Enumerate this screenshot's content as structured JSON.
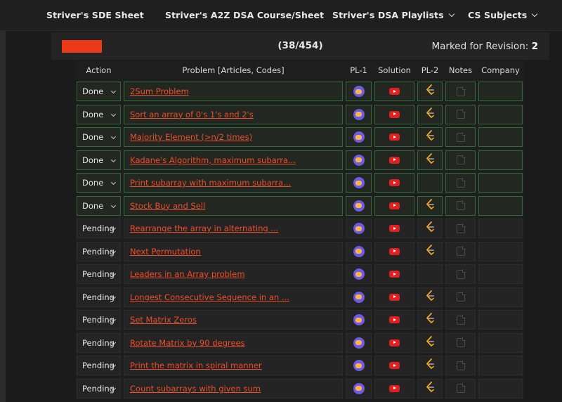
{
  "nav": {
    "items": [
      {
        "label": "Striver's SDE Sheet",
        "dropdown": false
      },
      {
        "label": "Striver's A2Z DSA Course/Sheet",
        "dropdown": false
      },
      {
        "label": "Striver's DSA Playlists",
        "dropdown": true
      },
      {
        "label": "CS Subjects",
        "dropdown": true
      }
    ]
  },
  "progress": {
    "count_text": "(38/454)",
    "solved": 38,
    "total": 454,
    "bar_color": "#ec3a19",
    "revision_label": "Marked for Revision:",
    "revision_count": "2"
  },
  "table": {
    "headers": {
      "action": "Action",
      "problem": "Problem [Articles, Codes]",
      "pl1": "PL-1",
      "solution": "Solution",
      "pl2": "PL-2",
      "notes": "Notes",
      "company": "Company"
    },
    "rows": [
      {
        "status": "Done",
        "problem": "2Sum Problem",
        "pl1": true,
        "solution": true,
        "pl2": true
      },
      {
        "status": "Done",
        "problem": "Sort an array of 0's 1's and 2's",
        "pl1": true,
        "solution": true,
        "pl2": true
      },
      {
        "status": "Done",
        "problem": "Majority Element (>n/2 times)",
        "pl1": true,
        "solution": true,
        "pl2": true
      },
      {
        "status": "Done",
        "problem": "Kadane's Algorithm, maximum subarra...",
        "pl1": true,
        "solution": true,
        "pl2": true
      },
      {
        "status": "Done",
        "problem": "Print subarray with maximum subarra...",
        "pl1": true,
        "solution": true,
        "pl2": false
      },
      {
        "status": "Done",
        "problem": "Stock Buy and Sell",
        "pl1": true,
        "solution": true,
        "pl2": true
      },
      {
        "status": "Pending",
        "problem": "Rearrange the array in alternating ...",
        "pl1": true,
        "solution": true,
        "pl2": true
      },
      {
        "status": "Pending",
        "problem": "Next Permutation",
        "pl1": true,
        "solution": true,
        "pl2": true
      },
      {
        "status": "Pending",
        "problem": "Leaders in an Array problem",
        "pl1": true,
        "solution": true,
        "pl2": false
      },
      {
        "status": "Pending",
        "problem": "Longest Consecutive Sequence in an ...",
        "pl1": true,
        "solution": true,
        "pl2": true
      },
      {
        "status": "Pending",
        "problem": "Set Matrix Zeros",
        "pl1": true,
        "solution": true,
        "pl2": true
      },
      {
        "status": "Pending",
        "problem": "Rotate Matrix by 90 degrees",
        "pl1": true,
        "solution": true,
        "pl2": true
      },
      {
        "status": "Pending",
        "problem": "Print the matrix in spiral manner",
        "pl1": true,
        "solution": true,
        "pl2": true
      },
      {
        "status": "Pending",
        "problem": "Count subarrays with given sum",
        "pl1": true,
        "solution": true,
        "pl2": true
      }
    ]
  },
  "colors": {
    "accent": "#ee4d29",
    "done_border": "#2e6b36",
    "youtube": "#e32020",
    "codingninjas": "#6b5ce6"
  },
  "icons": {
    "pl1": "codingninjas-icon",
    "solution": "youtube-icon",
    "pl2": "leetcode-icon",
    "notes": "notes-icon",
    "dropdown": "chevron-down-icon"
  }
}
